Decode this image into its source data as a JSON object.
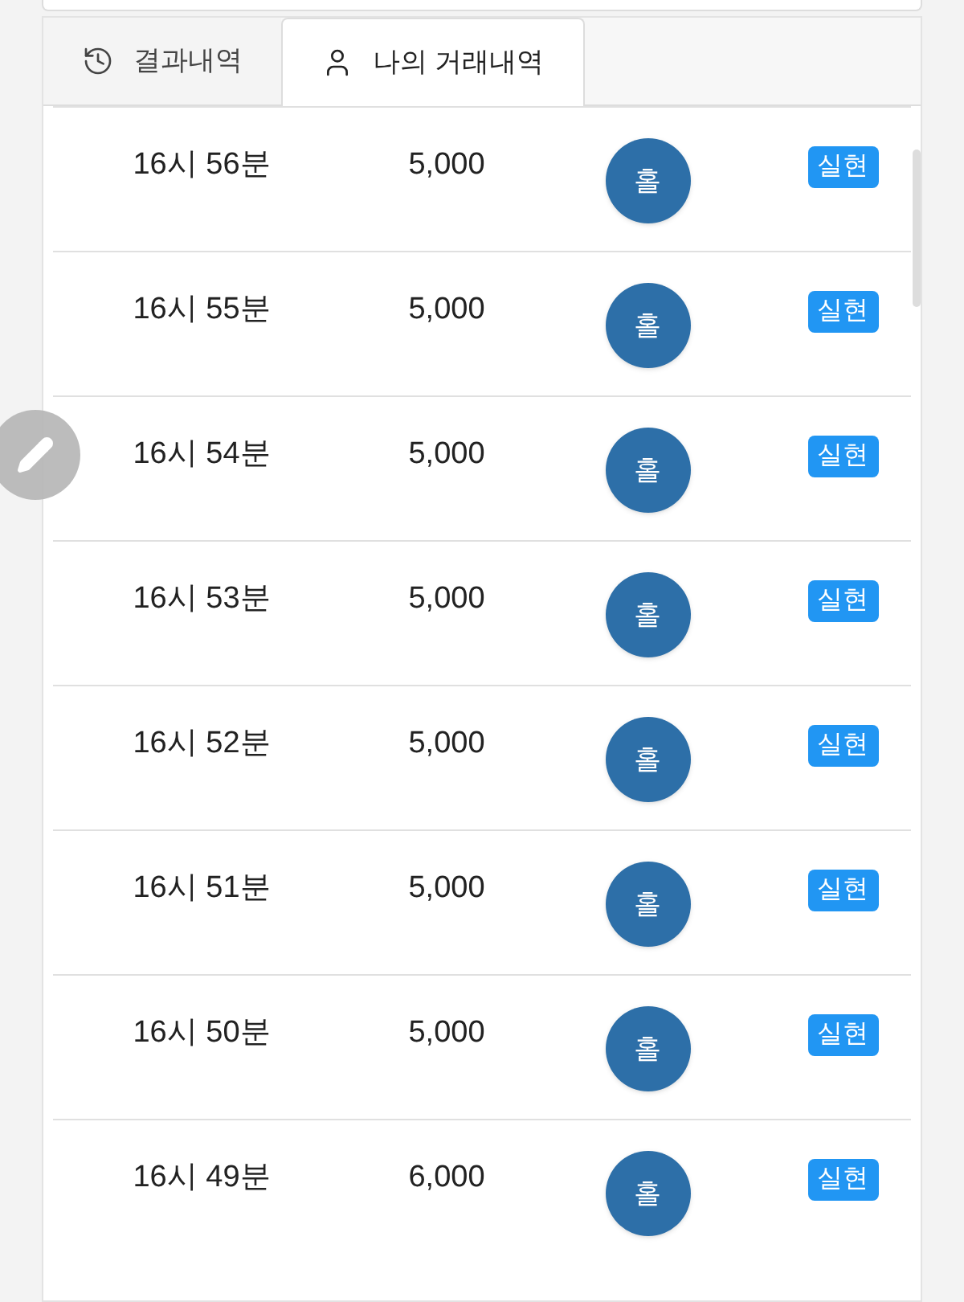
{
  "tabs": [
    {
      "label": "결과내역",
      "selected": false
    },
    {
      "label": "나의 거래내역",
      "selected": true
    }
  ],
  "rows": [
    {
      "time": "16시 56분",
      "amount": "5,000",
      "pick": "홀",
      "result": "실현"
    },
    {
      "time": "16시 55분",
      "amount": "5,000",
      "pick": "홀",
      "result": "실현"
    },
    {
      "time": "16시 54분",
      "amount": "5,000",
      "pick": "홀",
      "result": "실현"
    },
    {
      "time": "16시 53분",
      "amount": "5,000",
      "pick": "홀",
      "result": "실현"
    },
    {
      "time": "16시 52분",
      "amount": "5,000",
      "pick": "홀",
      "result": "실현"
    },
    {
      "time": "16시 51분",
      "amount": "5,000",
      "pick": "홀",
      "result": "실현"
    },
    {
      "time": "16시 50분",
      "amount": "5,000",
      "pick": "홀",
      "result": "실현"
    },
    {
      "time": "16시 49분",
      "amount": "6,000",
      "pick": "홀",
      "result": "실현"
    }
  ]
}
